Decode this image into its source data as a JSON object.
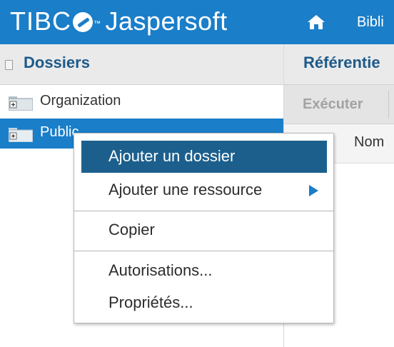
{
  "header": {
    "logo_tibco": "TIBC",
    "logo_tm": "™",
    "logo_product": "Jaspersoft",
    "home_icon": "home-icon",
    "nav_library": "Bibli"
  },
  "left_panel": {
    "title": "Dossiers",
    "tree": [
      {
        "label": "Organization",
        "icon": "folder-collapsed-icon",
        "selected": false
      },
      {
        "label": "Public",
        "icon": "folder-collapsed-icon",
        "selected": true
      }
    ]
  },
  "right_panel": {
    "title": "Référentie",
    "toolbar": {
      "run_label": "Exécuter"
    },
    "column_name": "Nom"
  },
  "context_menu": {
    "items": [
      {
        "label": "Ajouter un dossier",
        "highlighted": true
      },
      {
        "label": "Ajouter une ressource",
        "submenu": true
      },
      {
        "label": "Copier"
      },
      {
        "label": "Autorisations..."
      },
      {
        "label": "Propriétés..."
      }
    ]
  },
  "colors": {
    "top_bar": "#1a7ec9",
    "selection": "#1a7ec9",
    "menu_highlight": "#1c5f8d",
    "title_text": "#1d5a8a"
  }
}
